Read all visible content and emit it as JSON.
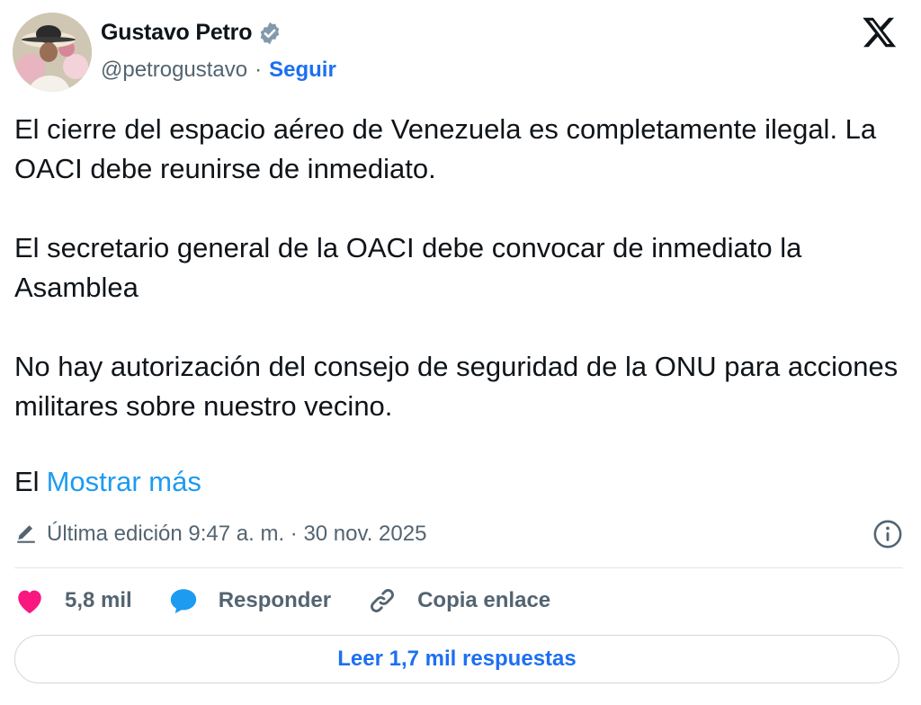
{
  "author": {
    "name": "Gustavo Petro",
    "handle": "@petrogustavo",
    "separator": "·",
    "follow_label": "Seguir",
    "verified_color": "#829aab"
  },
  "tweet": {
    "paragraphs": [
      "El cierre del espacio aéreo de Venezuela es completamente ilegal. La OACI debe reunirse de inmediato.",
      "El secretario general de la OACI debe convocar de inmediato la Asamblea",
      "No hay autorización del consejo de seguridad de la ONU para acciones militares sobre nuestro vecino."
    ],
    "truncated_start": "El",
    "show_more_label": "Mostrar más"
  },
  "meta": {
    "edited_text": "Última edición 9:47 a. m. · 30 nov. 2025",
    "pencil_icon": "pencil-icon",
    "info_icon": "info-icon"
  },
  "actions": {
    "likes": "5,8 mil",
    "reply_label": "Responder",
    "copy_label": "Copia enlace",
    "like_color": "#f91880",
    "reply_color": "#1d9bf0"
  },
  "replies_button": {
    "label": "Leer 1,7 mil respuestas"
  },
  "colors": {
    "link": "#1d9bf0",
    "follow": "#1d6ff2",
    "secondary_text": "#536471"
  }
}
